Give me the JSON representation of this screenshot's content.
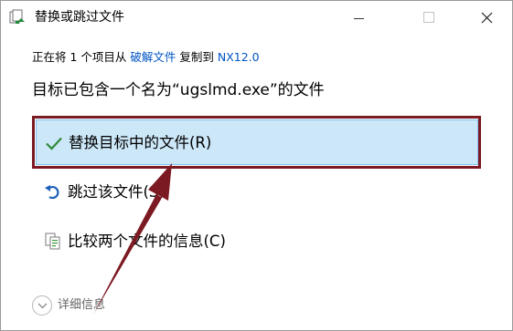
{
  "window": {
    "title": "替换或跳过文件",
    "controls": {
      "minimize_icon": "minimize-icon",
      "maximize_icon": "maximize-icon",
      "close_glyph": "✕"
    }
  },
  "status": {
    "prefix": "正在将 1 个项目从 ",
    "source": "破解文件",
    "middle": " 复制到 ",
    "destination": "NX12.0"
  },
  "message": "目标已包含一个名为“ugslmd.exe”的文件",
  "options": [
    {
      "label": "替换目标中的文件(R)",
      "icon": "checkmark-icon",
      "selected": true
    },
    {
      "label": "跳过该文件(S)",
      "icon": "undo-arrow-icon",
      "selected": false
    },
    {
      "label": "比较两个文件的信息(C)",
      "icon": "compare-files-icon",
      "selected": false
    }
  ],
  "details": {
    "label": "详细信息",
    "icon": "chevron-down-icon"
  },
  "colors": {
    "accent_link": "#0054c4",
    "selection_bg": "#cce7f8",
    "selection_border": "#80c3ef",
    "annotation_frame": "#7b1a22",
    "check_green": "#2e8b3a",
    "skip_blue": "#1e62b8"
  }
}
